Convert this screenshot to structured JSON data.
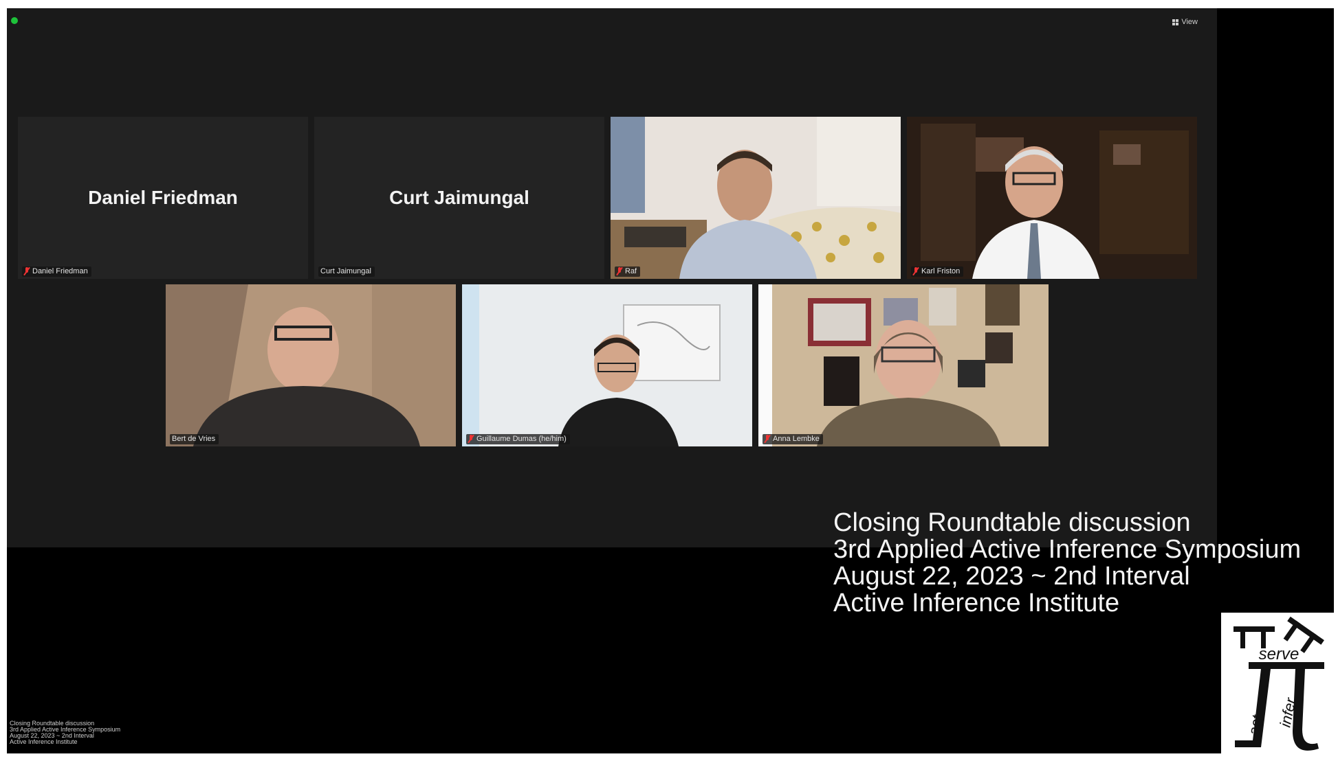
{
  "toolbar": {
    "view_label": "View"
  },
  "participants": [
    {
      "display_name": "Daniel Friedman",
      "label": "Daniel Friedman",
      "video": false,
      "muted": true
    },
    {
      "display_name": "Curt Jaimungal",
      "label": "Curt Jaimungal",
      "video": false,
      "muted": false
    },
    {
      "label": "Raf",
      "video": true,
      "muted": true
    },
    {
      "label": "Karl Friston",
      "video": true,
      "muted": true
    },
    {
      "label": "Bert de Vries",
      "video": true,
      "muted": false,
      "speaking": true
    },
    {
      "label": "Guillaume Dumas (he/him)",
      "video": true,
      "muted": true
    },
    {
      "label": "Anna Lembke",
      "video": true,
      "muted": true
    }
  ],
  "overlay": {
    "line1": "Closing Roundtable discussion",
    "line2": "3rd Applied Active Inference Symposium",
    "line3": "August 22, 2023 ~ 2nd Interval",
    "line4": "Active Inference Institute"
  },
  "small_caption": {
    "line1": "Closing Roundtable discussion",
    "line2": "3rd Applied Active Inference Symposium",
    "line3": "August 22, 2023 ~ 2nd Interval",
    "line4": "Active Inference Institute"
  },
  "logo": {
    "word1": "serve",
    "word2": "act",
    "word3": "infer"
  },
  "colors": {
    "speaking_border": "#2fc24a",
    "mute_red": "#e33333",
    "zoom_bg": "#1a1a1a"
  }
}
